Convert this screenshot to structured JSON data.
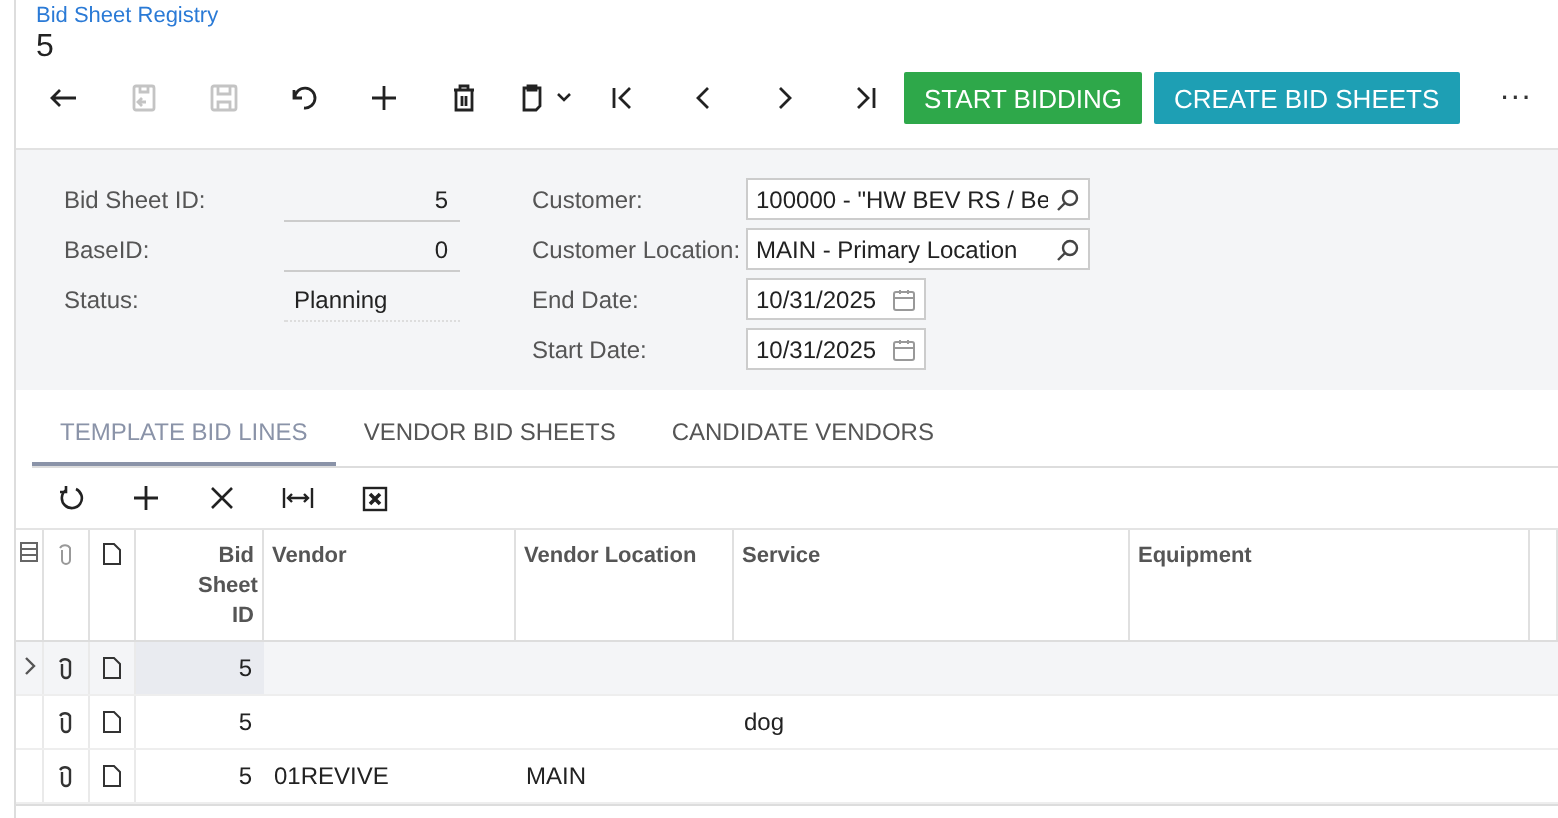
{
  "breadcrumb": "Bid Sheet Registry",
  "title": "5",
  "toolbar": [
    {
      "disabled": false
    },
    {
      "disabled": true
    },
    {
      "disabled": true
    },
    {
      "disabled": false
    },
    {
      "disabled": false
    },
    {
      "disabled": false
    },
    {
      "disabled": false
    },
    {
      "disabled": false
    },
    {
      "disabled": false
    },
    {
      "disabled": false
    },
    {
      "disabled": false
    }
  ],
  "actions": [
    {
      "label": "START BIDDING",
      "color": "#2ea84a"
    },
    {
      "label": "CREATE BID SHEETS",
      "color": "#1e9fb4"
    }
  ],
  "more": "···",
  "form_left": [
    {
      "label": "Bid Sheet ID:",
      "value": "5",
      "kind": "number"
    },
    {
      "label": "BaseID:",
      "value": "0",
      "kind": "number"
    },
    {
      "label": "Status:",
      "value": "Planning",
      "kind": "text"
    }
  ],
  "form_right": [
    {
      "label": "Customer:",
      "value": "100000 - \"HW BEV RS / Be",
      "kind": "lookup"
    },
    {
      "label": "Customer Location:",
      "value": "MAIN - Primary Location",
      "kind": "lookup"
    },
    {
      "label": "End Date:",
      "value": "10/31/2025",
      "kind": "date"
    },
    {
      "label": "Start Date:",
      "value": "10/31/2025",
      "kind": "date"
    }
  ],
  "tabs": [
    {
      "label": "TEMPLATE BID LINES",
      "selected": true
    },
    {
      "label": "VENDOR BID SHEETS",
      "selected": false
    },
    {
      "label": "CANDIDATE VENDORS",
      "selected": false
    }
  ],
  "table": {
    "columns": [
      "Bid Sheet ID",
      "Vendor",
      "Vendor Location",
      "Service",
      "Equipment"
    ],
    "rows": [
      {
        "selected": true,
        "cells": [
          "5",
          "",
          "",
          "",
          ""
        ]
      },
      {
        "selected": false,
        "cells": [
          "5",
          "",
          "",
          "dog",
          ""
        ]
      },
      {
        "selected": false,
        "cells": [
          "5",
          "01REVIVE",
          "MAIN",
          "",
          ""
        ]
      }
    ]
  }
}
